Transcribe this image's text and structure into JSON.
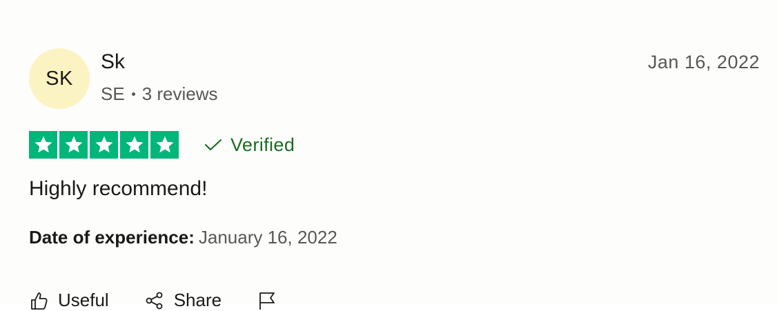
{
  "consumer": {
    "initials": "SK",
    "name": "Sk",
    "country": "SE",
    "reviews_count": "3 reviews"
  },
  "review": {
    "published_date": "Jan 16, 2022",
    "rating": 5,
    "rating_max": 5,
    "verified_label": "Verified",
    "title": "Highly recommend!",
    "experience_label": "Date of experience:",
    "experience_date": "January 16, 2022"
  },
  "actions": {
    "useful_label": "Useful",
    "share_label": "Share"
  },
  "colors": {
    "star_green": "#00b67a",
    "verified_green": "#1c6c25",
    "avatar_bg": "#fcf3c2"
  },
  "icons": [
    "star-icon",
    "check-icon",
    "thumbs-up-icon",
    "share-icon",
    "flag-icon"
  ]
}
